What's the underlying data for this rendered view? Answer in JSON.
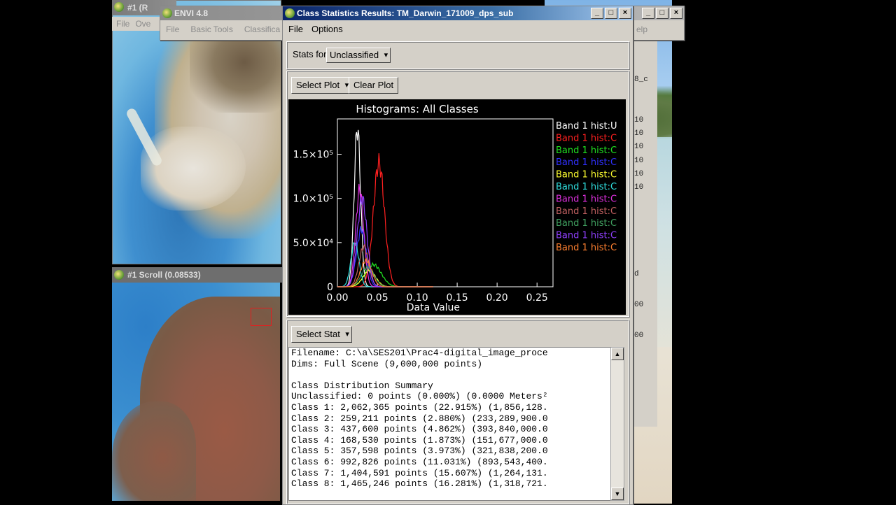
{
  "img_windows": {
    "top_title": "#1 (R",
    "top_menu": [
      "File",
      "Ove"
    ],
    "scroll_title": "#1 Scroll (0.08533)"
  },
  "envi": {
    "title": "ENVI 4.8",
    "menu": [
      "File",
      "Basic Tools",
      "Classifica",
      "elp"
    ]
  },
  "right_panel": {
    "texts": [
      "8_c",
      "10",
      "10",
      "10",
      "10",
      "10",
      "10",
      "d",
      "00",
      "00"
    ]
  },
  "dialog": {
    "title": "Class Statistics Results: TM_Darwin_171009_dps_sub",
    "menu": [
      "File",
      "Options"
    ],
    "stats_for_label": "Stats for",
    "stats_for_value": "Unclassified",
    "select_plot": "Select Plot",
    "clear_plot": "Clear Plot",
    "select_stat": "Select Stat"
  },
  "chart_data": {
    "type": "line",
    "title": "Histograms: All Classes",
    "xlabel": "Data Value",
    "ylabel": "",
    "xlim": [
      0.0,
      0.27
    ],
    "ylim": [
      0,
      190000
    ],
    "x_ticks": [
      "0.00",
      "0.05",
      "0.10",
      "0.15",
      "0.20",
      "0.25"
    ],
    "y_ticks": [
      "0",
      "5.0×10⁴",
      "1.0×10⁵",
      "1.5×10⁵"
    ],
    "y_tick_values": [
      0,
      50000,
      100000,
      150000
    ],
    "x_tick_values": [
      0.0,
      0.05,
      0.1,
      0.15,
      0.2,
      0.25
    ],
    "legend_position": "right",
    "series": [
      {
        "name": "Band 1 hist:U",
        "color": "#ffffff",
        "peak_x": 0.025,
        "peak_y": 180000,
        "width": 0.004
      },
      {
        "name": "Band 1 hist:C",
        "color": "#ff2020",
        "peak_x": 0.052,
        "peak_y": 140000,
        "width": 0.007
      },
      {
        "name": "Band 1 hist:C",
        "color": "#20e020",
        "peak_x": 0.045,
        "peak_y": 25000,
        "width": 0.01
      },
      {
        "name": "Band 1 hist:C",
        "color": "#3030ff",
        "peak_x": 0.03,
        "peak_y": 65000,
        "width": 0.006
      },
      {
        "name": "Band 1 hist:C",
        "color": "#ffff30",
        "peak_x": 0.04,
        "peak_y": 18000,
        "width": 0.008
      },
      {
        "name": "Band 1 hist:C",
        "color": "#30e0e0",
        "peak_x": 0.022,
        "peak_y": 50000,
        "width": 0.005
      },
      {
        "name": "Band 1 hist:C",
        "color": "#e030e0",
        "peak_x": 0.028,
        "peak_y": 110000,
        "width": 0.005
      },
      {
        "name": "Band 1 hist:C",
        "color": "#c06060",
        "peak_x": 0.033,
        "peak_y": 45000,
        "width": 0.006
      },
      {
        "name": "Band 1 hist:C",
        "color": "#40a060",
        "peak_x": 0.038,
        "peak_y": 22000,
        "width": 0.008
      },
      {
        "name": "Band 1 hist:C",
        "color": "#9040ff",
        "peak_x": 0.031,
        "peak_y": 100000,
        "width": 0.006
      },
      {
        "name": "Band 1 hist:C",
        "color": "#ff8030",
        "peak_x": 0.036,
        "peak_y": 30000,
        "width": 0.007
      }
    ]
  },
  "stats_text": [
    "Filename: C:\\a\\SES201\\Prac4-digital_image_proce",
    "Dims: Full Scene (9,000,000 points)",
    "",
    "Class Distribution Summary",
    "Unclassified: 0 points (0.000%) (0.0000 Meters²",
    "Class 1: 2,062,365 points (22.915%) (1,856,128.",
    "Class 2: 259,211 points (2.880%) (233,289,900.0",
    "Class 3: 437,600 points (4.862%) (393,840,000.0",
    "Class 4: 168,530 points (1.873%) (151,677,000.0",
    "Class 5: 357,598 points (3.973%) (321,838,200.0",
    "Class 6: 992,826 points (11.031%) (893,543,400.",
    "Class 7: 1,404,591 points (15.607%) (1,264,131.",
    "Class 8: 1,465,246 points (16.281%) (1,318,721."
  ]
}
